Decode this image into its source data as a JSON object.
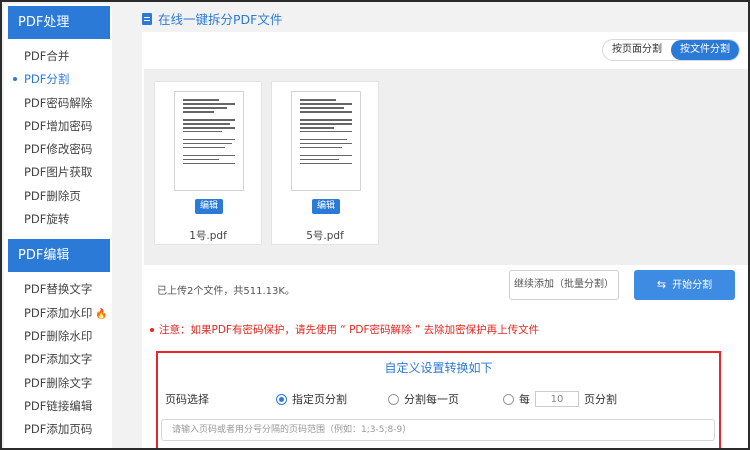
{
  "sidebar": {
    "section1": "PDF处理",
    "items1": [
      "PDF合并",
      "PDF分割",
      "PDF密码解除",
      "PDF增加密码",
      "PDF修改密码",
      "PDF图片获取",
      "PDF删除页",
      "PDF旋转"
    ],
    "section2": "PDF编辑",
    "items2": [
      "PDF替换文字",
      "PDF添加水印",
      "PDF删除水印",
      "PDF添加文字",
      "PDF删除文字",
      "PDF链接编辑",
      "PDF添加页码"
    ]
  },
  "main": {
    "title": "在线一键拆分PDF文件",
    "toggle": {
      "by_page": "按页面分割",
      "by_file": "按文件分割"
    },
    "files": [
      {
        "name": "1号.pdf",
        "edit": "编辑"
      },
      {
        "name": "5号.pdf",
        "edit": "编辑"
      }
    ],
    "upload_info": "已上传2个文件，共511.13K。",
    "continue_add": "继续添加（批量分割）",
    "start_split": "开始分割",
    "notice": "注意：如果PDF有密码保护，请先使用 “ PDF密码解除 ” 去除加密保护再上传文件"
  },
  "settings": {
    "title": "自定义设置转换如下",
    "label": "页码选择",
    "opt_specified": "指定页分割",
    "opt_each": "分割每一页",
    "opt_every_prefix": "每",
    "opt_every_value": "10",
    "opt_every_suffix": "页分割",
    "range_placeholder": "请输入页码或者用分号分隔的页码范围（例如：1;3-5;8-9）"
  },
  "colors": {
    "accent": "#2b7ad8",
    "notice": "#e4261f",
    "highlight_border": "#e8262c"
  }
}
